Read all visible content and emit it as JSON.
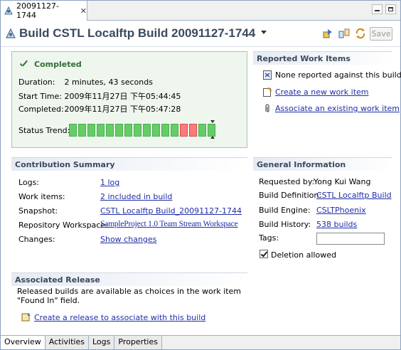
{
  "tab": {
    "label": "20091127-1744"
  },
  "header": {
    "title": "Build CSTL Localftp Build 20091127-1744",
    "save_label": "Save"
  },
  "status": {
    "title": "Completed",
    "duration_label": "Duration:",
    "duration_value": "2 minutes, 43 seconds",
    "start_label": "Start Time:",
    "start_value": "2009年11月27日 下午05:44:45",
    "completed_label": "Completed:",
    "completed_value": "2009年11月27日 下午05:47:28",
    "trend_label": "Status Trend:",
    "trend": [
      "ok",
      "ok",
      "ok",
      "ok",
      "ok",
      "ok",
      "ok",
      "ok",
      "ok",
      "ok",
      "ok",
      "ok",
      "fail",
      "fail",
      "ok",
      "ok"
    ]
  },
  "reported": {
    "title": "Reported Work Items",
    "none_text": "None reported against this build",
    "create_link": "Create a new work item",
    "associate_link": "Associate an existing work item"
  },
  "contribution": {
    "title": "Contribution Summary",
    "logs_label": "Logs:",
    "logs_value": "1 log",
    "workitems_label": "Work items:",
    "workitems_value": "2 included in build",
    "snapshot_label": "Snapshot:",
    "snapshot_value": "CSTL Localftp Build_20091127-1744",
    "repo_label": "Repository Workspace:",
    "repo_value": "SampleProject 1.0 Team Stream Workspace",
    "changes_label": "Changes:",
    "changes_value": "Show changes"
  },
  "general": {
    "title": "General Information",
    "requested_label": "Requested by:",
    "requested_value": "Yong Kui Wang",
    "definition_label": "Build Definition:",
    "definition_value": "CSTL Localftp Build",
    "engine_label": "Build Engine:",
    "engine_value": "CSLTPhoenix",
    "history_label": "Build History:",
    "history_value": "538 builds",
    "tags_label": "Tags:",
    "tags_value": "",
    "deletion_label": "Deletion allowed"
  },
  "release": {
    "title": "Associated Release",
    "description": "Released builds are available as choices in the work item \"Found In\" field.",
    "create_link": "Create a release to associate with this build"
  },
  "bottom_tabs": [
    "Overview",
    "Activities",
    "Logs",
    "Properties"
  ]
}
